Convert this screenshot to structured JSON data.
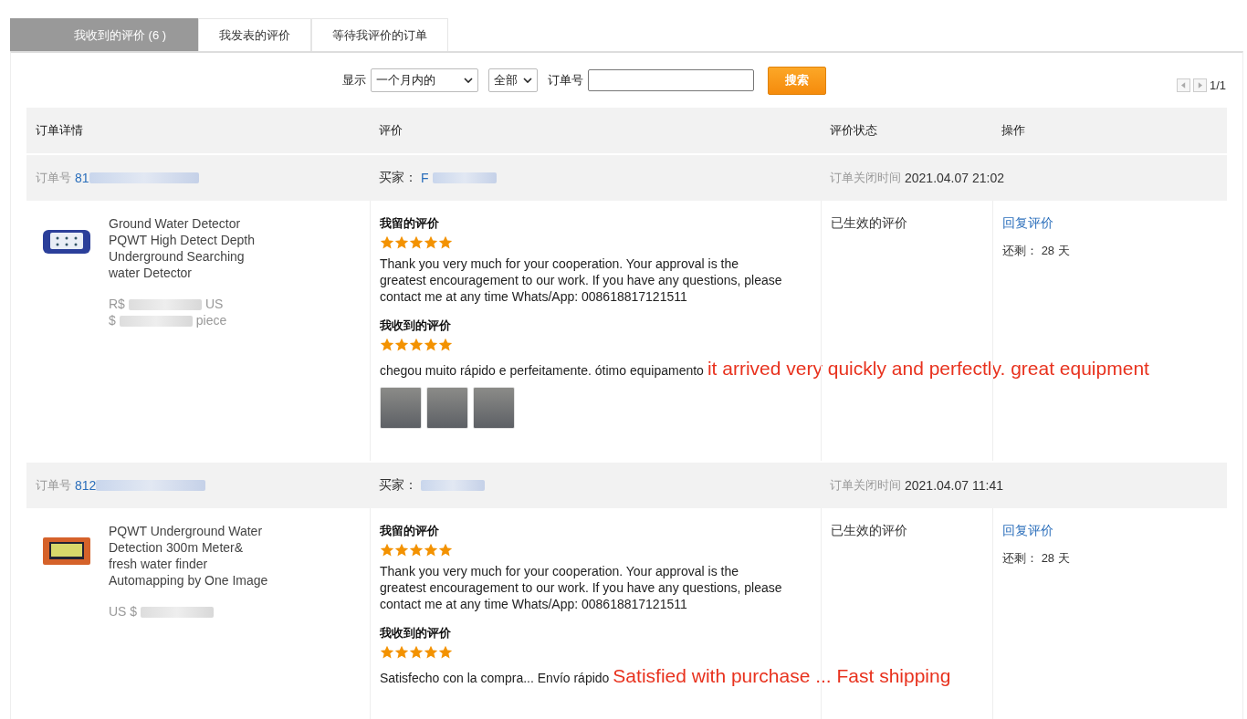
{
  "tabs": [
    {
      "label": "我收到的评价 (6 )",
      "selected": true
    },
    {
      "label": "我发表的评价",
      "selected": false
    },
    {
      "label": "等待我评价的订单",
      "selected": false
    }
  ],
  "filter": {
    "show_label": "显示",
    "period": "一个月内的",
    "type": "全部",
    "order_label": "订单号",
    "search_button": "搜索"
  },
  "pagination": {
    "page": "1/1"
  },
  "table": {
    "columns": [
      "订单详情",
      "评价",
      "评价状态",
      "操作"
    ],
    "orders": [
      {
        "order_label": "订单号",
        "order_number": "81",
        "buyer_label": "买家：",
        "buyer": "F",
        "close_label": "订单关闭时间",
        "close_time": "2021.04.07 21:02",
        "kind": "handheld",
        "product_title": "Ground Water Detector PQWT High Detect Depth Underground Searching water Detector",
        "price": [
          {
            "kind": "text",
            "text": "R$"
          },
          {
            "kind": "blur"
          },
          {
            "kind": "text",
            "text": "US"
          },
          {
            "kind": "break"
          },
          {
            "kind": "text",
            "text": "$"
          },
          {
            "kind": "blur"
          },
          {
            "kind": "text",
            "text": "piece"
          }
        ],
        "my_review": {
          "label": "我留的评价",
          "stars": 5,
          "text": "Thank you very much for your cooperation. Your approval is the greatest encouragement to our work. If you have any questions, please contact me at any time Whats/App: 008618817121511"
        },
        "received_review": {
          "label": "我收到的评价",
          "stars": 5,
          "text": "chegou muito rápido e perfeitamente. ótimo equipamento",
          "translation": "it arrived very quickly and perfectly. great equipment",
          "photos": [
            {
              "kind": "photo"
            },
            {
              "kind": "photo"
            },
            {
              "kind": "photo"
            }
          ]
        },
        "status": "已生效的评价",
        "reply_link": "回复评价",
        "remaining_label": "还剩：",
        "remaining": "28 天"
      },
      {
        "order_label": "订单号",
        "order_number": "812",
        "buyer_label": "买家：",
        "close_label": "订单关闭时间",
        "close_time": "2021.04.07 11:41",
        "kind": "tablet",
        "product_title": "PQWT Underground Water Detection 300m Meter& fresh water finder Automapping by One Image",
        "price": [
          {
            "kind": "text",
            "text": "US $"
          },
          {
            "kind": "blur"
          }
        ],
        "my_review": {
          "label": "我留的评价",
          "stars": 5,
          "text": "Thank you very much for your cooperation. Your approval is the greatest encouragement to our work. If you have any questions, please contact me at any time Whats/App: 008618817121511"
        },
        "received_review": {
          "label": "我收到的评价",
          "stars": 5,
          "text": "Satisfecho con la compra... Envío rápido",
          "translation": "Satisfied with purchase ... Fast shipping"
        },
        "status": "已生效的评价",
        "reply_link": "回复评价",
        "remaining_label": "还剩：",
        "remaining": "28 天"
      }
    ]
  }
}
